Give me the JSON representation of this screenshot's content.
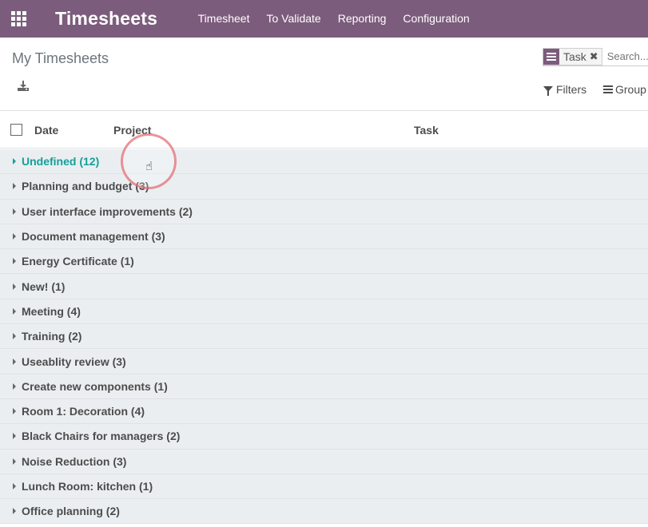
{
  "navbar": {
    "app_title": "Timesheets",
    "menu": [
      {
        "label": "Timesheet"
      },
      {
        "label": "To Validate"
      },
      {
        "label": "Reporting"
      },
      {
        "label": "Configuration"
      }
    ],
    "background_color": "#7c5c7c"
  },
  "control_panel": {
    "breadcrumb": "My Timesheets",
    "download_icon": "download-icon",
    "search": {
      "facet_value": "Task",
      "facet_icon": "group-by-icon",
      "placeholder": "Search..."
    },
    "filters_label": "Filters",
    "groupby_label": "Group"
  },
  "list": {
    "columns": [
      {
        "label": "Date"
      },
      {
        "label": "Project"
      },
      {
        "label": "Task"
      }
    ],
    "groups": [
      {
        "label": "Undefined (12)",
        "active": true
      },
      {
        "label": "Planning and budget (3)"
      },
      {
        "label": "User interface improvements (2)"
      },
      {
        "label": "Document management (3)"
      },
      {
        "label": "Energy Certificate (1)"
      },
      {
        "label": "New! (1)"
      },
      {
        "label": "Meeting (4)"
      },
      {
        "label": "Training (2)"
      },
      {
        "label": "Useablity review (3)"
      },
      {
        "label": "Create new components (1)"
      },
      {
        "label": "Room 1: Decoration (4)"
      },
      {
        "label": "Black Chairs for managers (2)"
      },
      {
        "label": "Noise Reduction (3)"
      },
      {
        "label": "Lunch Room: kitchen (1)"
      },
      {
        "label": "Office planning (2)"
      }
    ]
  },
  "colors": {
    "brand": "#7c5c7c",
    "active_group": "#13a09a",
    "group_background": "#eaeef0"
  }
}
